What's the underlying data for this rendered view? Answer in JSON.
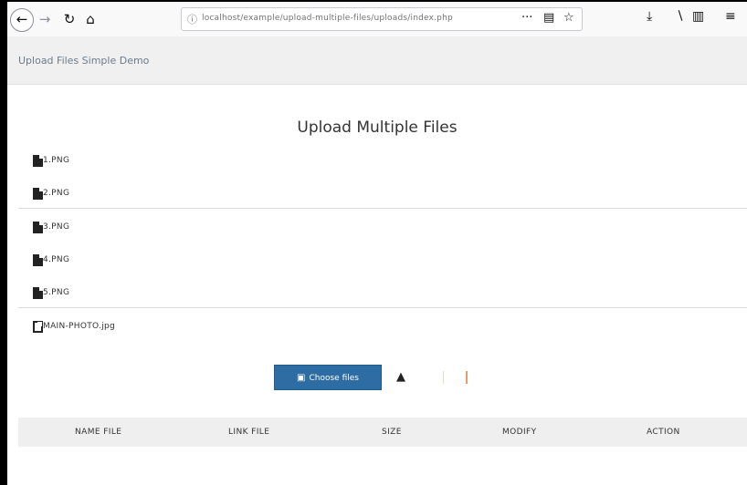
{
  "browser": {
    "url": "localhost/example/upload-multiple-files/uploads/index.php",
    "icons": {
      "back": "arrow-left-icon",
      "forward": "arrow-right-icon",
      "reload": "reload-icon",
      "home": "home-icon",
      "page_actions": "more-icon",
      "reader": "reader-icon",
      "bookmark": "star-icon",
      "download": "download-icon",
      "library": "library-icon",
      "sidebar": "sidebar-icon",
      "menu": "menu-icon"
    }
  },
  "bookmarks_bar": {
    "title": "Upload Files Simple Demo"
  },
  "page": {
    "heading": "Upload Multiple Files",
    "files": [
      {
        "name": "1.PNG",
        "icon": "file-icon"
      },
      {
        "name": "2.PNG",
        "icon": "file-icon"
      },
      {
        "name": "3.PNG",
        "icon": "file-icon"
      },
      {
        "name": "4.PNG",
        "icon": "file-icon"
      },
      {
        "name": "5.PNG",
        "icon": "file-icon"
      },
      {
        "name": "MAIN-PHOTO.jpg",
        "icon": "image-icon"
      }
    ],
    "choose_button": "Choose files",
    "table_headers": [
      "NAME FILE",
      "LINK FILE",
      "SIZE",
      "MODIFY",
      "ACTION"
    ]
  },
  "colors": {
    "primary_button": "#2d6da3",
    "table_header_bg": "#efefef",
    "toolbar_bg": "#f9f9fa"
  }
}
